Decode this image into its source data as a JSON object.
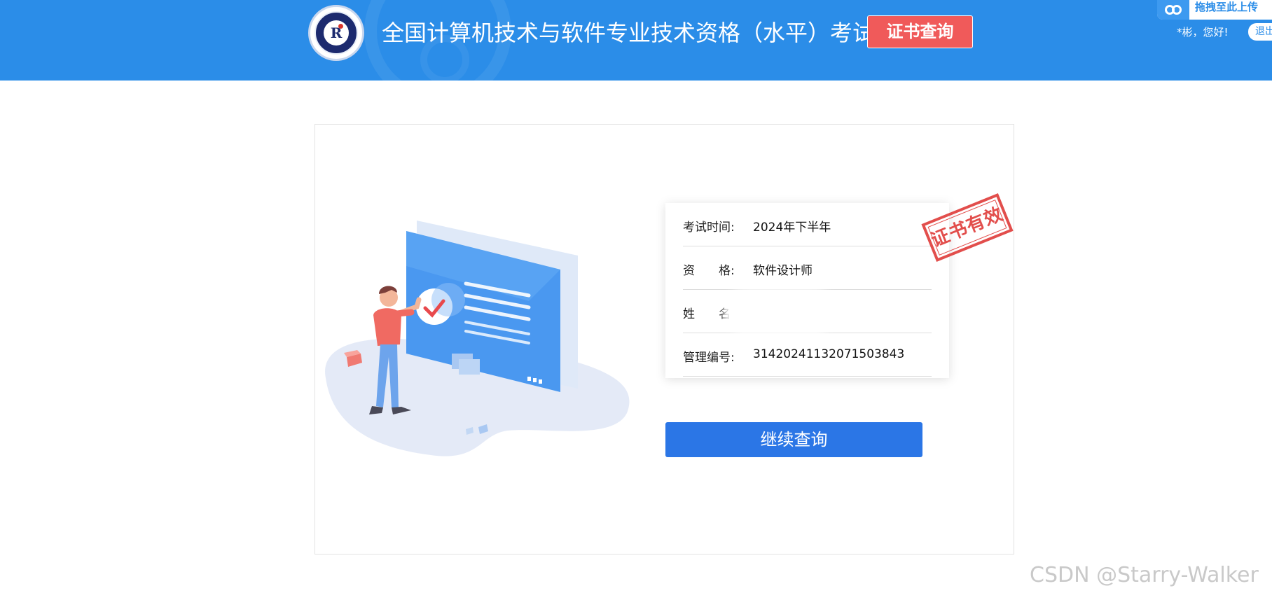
{
  "header": {
    "logo_text": "R",
    "title": "全国计算机技术与软件专业技术资格（水平）考试",
    "cert_query_label": "证书查询",
    "upload_label": "拖拽至此上传",
    "greeting": "*彬，您好!",
    "logout_label": "退出",
    "background_color": "#2b8de8"
  },
  "result": {
    "rows": [
      {
        "label": "考试时间:",
        "value": "2024年下半年"
      },
      {
        "label": "资　　格:",
        "value": "软件设计师"
      },
      {
        "label": "姓　　名",
        "value": ""
      },
      {
        "label": "管理编号:",
        "value": "31420241132071503843"
      }
    ],
    "stamp_text": "证书有效",
    "continue_label": "继续查询"
  },
  "watermark": "CSDN @Starry-Walker",
  "colors": {
    "primary": "#2b76e6",
    "accent_red": "#f05a5a",
    "stamp_red": "#e0403d"
  }
}
